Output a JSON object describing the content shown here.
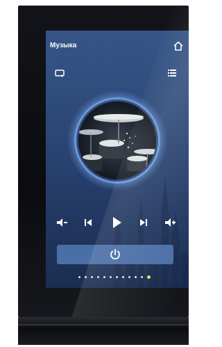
{
  "screen": {
    "title": "Музыка"
  },
  "icons": {
    "home": "home-icon",
    "repeat": "repeat-icon",
    "playlist": "playlist-icon",
    "volume_down": "volume-down-icon",
    "previous": "previous-track-icon",
    "play": "play-icon",
    "next": "next-track-icon",
    "volume_up": "volume-up-icon",
    "power": "power-icon"
  },
  "pagination": {
    "total": 12,
    "active_index": 11
  },
  "colors": {
    "screen_top": "#365687",
    "screen_bottom": "#1b2e51",
    "accent_ring": "#6c98d8",
    "power_bar": "#4a6ea6",
    "active_dot": "#e8d76a"
  }
}
